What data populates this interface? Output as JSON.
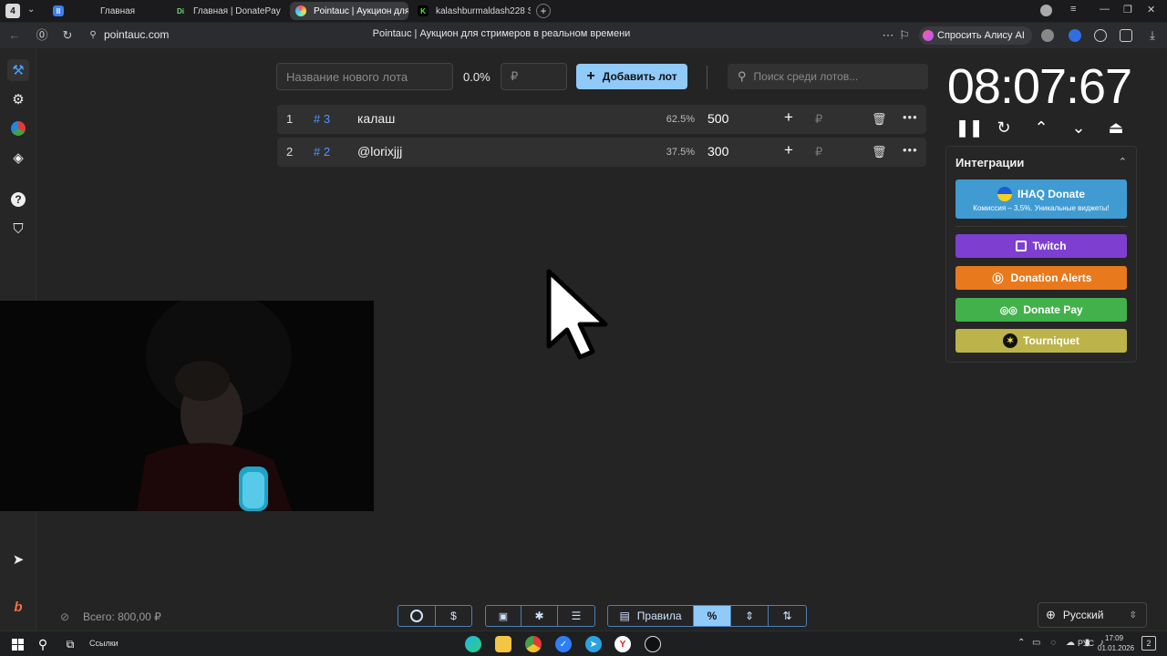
{
  "browser": {
    "tab_count": "4",
    "tabs": [
      {
        "label": "",
        "favicon": "pinned-tab-icon"
      },
      {
        "label": "Главная",
        "favicon": "home-icon"
      },
      {
        "label": "Главная | DonatePay",
        "favicon": "donatepay-icon"
      },
      {
        "label": "Pointauc | Аукцион для",
        "favicon": "pointauc-icon"
      },
      {
        "label": "kalashburmaldash228 Stre",
        "favicon": "kick-icon"
      }
    ],
    "url": "pointauc.com",
    "page_title": "Pointauc | Аукцион для стримеров в реальном времени",
    "alice_label": "Спросить Алису AI"
  },
  "lot_form": {
    "name_placeholder": "Название нового лота",
    "percent": "0.0%",
    "amount_placeholder": "₽",
    "add_button": "Добавить лот",
    "search_placeholder": "Поиск среди лотов..."
  },
  "lots": [
    {
      "index": "1",
      "tag": "# 3",
      "name": "калаш",
      "percent": "62.5%",
      "amount": "500",
      "currency": "₽"
    },
    {
      "index": "2",
      "tag": "# 2",
      "name": "@lorixjjj",
      "percent": "37.5%",
      "amount": "300",
      "currency": "₽"
    }
  ],
  "timer": {
    "display": "08:07:67"
  },
  "integrations": {
    "title": "Интеграции",
    "items": [
      {
        "label": "IHAQ Donate",
        "sublabel": "Комиссия – 3,5%. Уникальные виджеты!",
        "color": "#3f9bd1"
      },
      {
        "label": "Twitch",
        "color": "#7e3fd1"
      },
      {
        "label": "Donation Alerts",
        "color": "#e8791c"
      },
      {
        "label": "Donate Pay",
        "color": "#43b14b"
      },
      {
        "label": "Tourniquet",
        "color": "#bcb44a"
      }
    ]
  },
  "footer": {
    "total": "Всего: 800,00 ₽",
    "rules": "Правила",
    "language": "Русский"
  },
  "taskbar": {
    "links": "Ссылки",
    "lang": "РУС",
    "time": "17:09",
    "date": "01.01.2026",
    "notifications": "2"
  },
  "colors": {
    "accent": "#90caf9",
    "background": "#242424",
    "tag": "#4d96ff"
  }
}
